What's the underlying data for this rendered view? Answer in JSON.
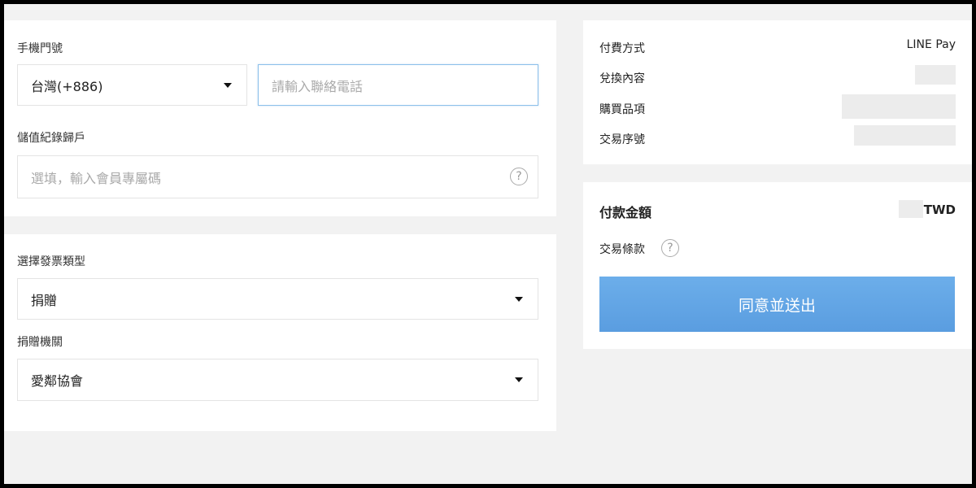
{
  "phone": {
    "label": "手機門號",
    "country_value": "台灣(+886)",
    "number_placeholder": "請輸入聯絡電話"
  },
  "stored_account": {
    "label": "儲值紀錄歸戶",
    "placeholder": "選填，輸入會員專屬碼"
  },
  "invoice": {
    "type_label": "選擇發票類型",
    "type_value": "捐贈",
    "org_label": "捐贈機關",
    "org_value": "愛鄰協會"
  },
  "summary": {
    "payment_method_label": "付費方式",
    "payment_method_value": "LINE Pay",
    "redeem_label": "兌換內容",
    "item_label": "購買品項",
    "serial_label": "交易序號"
  },
  "total": {
    "label": "付款金額",
    "currency": "TWD",
    "terms_label": "交易條款",
    "submit_label": "同意並送出"
  },
  "icons": {
    "help": "?"
  }
}
